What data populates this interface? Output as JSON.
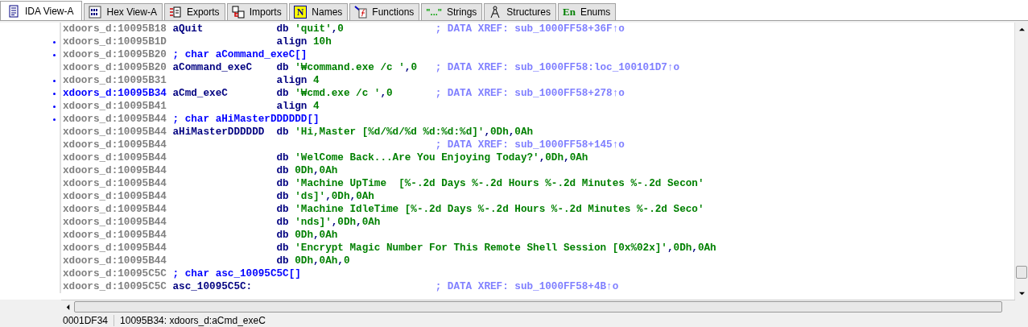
{
  "tabs": [
    {
      "label": "IDA View-A",
      "kind": "disasm",
      "selected": true
    },
    {
      "label": "Hex View-A",
      "kind": "hex",
      "selected": false
    },
    {
      "label": "Exports",
      "kind": "exports",
      "selected": false
    },
    {
      "label": "Imports",
      "kind": "imports",
      "selected": false
    },
    {
      "label": "Names",
      "kind": "names",
      "icon_text": "N",
      "selected": false
    },
    {
      "label": "Functions",
      "kind": "functions",
      "selected": false
    },
    {
      "label": "Strings",
      "kind": "strings",
      "icon_text": "\"...\"",
      "selected": false
    },
    {
      "label": "Structures",
      "kind": "structures",
      "selected": false
    },
    {
      "label": "Enums",
      "kind": "enums",
      "icon_text": "En",
      "selected": false
    }
  ],
  "listing": {
    "rows": [
      {
        "kind": "code",
        "address": "xdoors_d:10095B18",
        "bullet": false,
        "selected": false,
        "label": "aQuit",
        "mnemonic": "db",
        "operands": "'quit',0",
        "comment": "; DATA XREF: sub_1000FF58+36F↑o"
      },
      {
        "kind": "code",
        "address": "xdoors_d:10095B1D",
        "bullet": true,
        "selected": false,
        "mnemonic": "align",
        "operands": "10h"
      },
      {
        "kind": "decl",
        "address": "xdoors_d:10095B20",
        "bullet": true,
        "selected": false,
        "text": "; char aCommand_exeC[]"
      },
      {
        "kind": "code",
        "address": "xdoors_d:10095B20",
        "bullet": false,
        "selected": false,
        "label": "aCommand_exeC",
        "mnemonic": "db",
        "operands": "'₩command.exe /c ',0",
        "comment": "; DATA XREF: sub_1000FF58:loc_100101D7↑o"
      },
      {
        "kind": "code",
        "address": "xdoors_d:10095B31",
        "bullet": true,
        "selected": false,
        "mnemonic": "align",
        "operands": "4"
      },
      {
        "kind": "code",
        "address": "xdoors_d:10095B34",
        "bullet": true,
        "selected": true,
        "label": "aCmd_exeC",
        "mnemonic": "db",
        "operands": "'₩cmd.exe /c ',0",
        "comment": "; DATA XREF: sub_1000FF58+278↑o"
      },
      {
        "kind": "code",
        "address": "xdoors_d:10095B41",
        "bullet": true,
        "selected": false,
        "mnemonic": "align",
        "operands": "4"
      },
      {
        "kind": "decl",
        "address": "xdoors_d:10095B44",
        "bullet": true,
        "selected": false,
        "text": "; char aHiMasterDDDDDD[]"
      },
      {
        "kind": "code",
        "address": "xdoors_d:10095B44",
        "bullet": false,
        "selected": false,
        "label": "aHiMasterDDDDDD",
        "mnemonic": "db",
        "operands": "'Hi,Master [%d/%d/%d %d:%d:%d]',0Dh,0Ah"
      },
      {
        "kind": "code",
        "address": "xdoors_d:10095B44",
        "bullet": false,
        "selected": false,
        "comment": "; DATA XREF: sub_1000FF58+145↑o"
      },
      {
        "kind": "code",
        "address": "xdoors_d:10095B44",
        "bullet": false,
        "selected": false,
        "mnemonic": "db",
        "operands": "'WelCome Back...Are You Enjoying Today?',0Dh,0Ah"
      },
      {
        "kind": "code",
        "address": "xdoors_d:10095B44",
        "bullet": false,
        "selected": false,
        "mnemonic": "db",
        "operands": "0Dh,0Ah"
      },
      {
        "kind": "code",
        "address": "xdoors_d:10095B44",
        "bullet": false,
        "selected": false,
        "mnemonic": "db",
        "operands": "'Machine UpTime  [%-.2d Days %-.2d Hours %-.2d Minutes %-.2d Secon'"
      },
      {
        "kind": "code",
        "address": "xdoors_d:10095B44",
        "bullet": false,
        "selected": false,
        "mnemonic": "db",
        "operands": "'ds]',0Dh,0Ah"
      },
      {
        "kind": "code",
        "address": "xdoors_d:10095B44",
        "bullet": false,
        "selected": false,
        "mnemonic": "db",
        "operands": "'Machine IdleTime [%-.2d Days %-.2d Hours %-.2d Minutes %-.2d Seco'"
      },
      {
        "kind": "code",
        "address": "xdoors_d:10095B44",
        "bullet": false,
        "selected": false,
        "mnemonic": "db",
        "operands": "'nds]',0Dh,0Ah"
      },
      {
        "kind": "code",
        "address": "xdoors_d:10095B44",
        "bullet": false,
        "selected": false,
        "mnemonic": "db",
        "operands": "0Dh,0Ah"
      },
      {
        "kind": "code",
        "address": "xdoors_d:10095B44",
        "bullet": false,
        "selected": false,
        "mnemonic": "db",
        "operands": "'Encrypt Magic Number For This Remote Shell Session [0x%02x]',0Dh,0Ah"
      },
      {
        "kind": "code",
        "address": "xdoors_d:10095B44",
        "bullet": false,
        "selected": false,
        "mnemonic": "db",
        "operands": "0Dh,0Ah,0"
      },
      {
        "kind": "decl",
        "address": "xdoors_d:10095C5C",
        "bullet": false,
        "selected": false,
        "text": "; char asc_10095C5C[]"
      },
      {
        "kind": "code",
        "address": "xdoors_d:10095C5C",
        "bullet": false,
        "selected": false,
        "label": "asc_10095C5C:",
        "comment": "; DATA XREF: sub_1000FF58+4B↑o"
      }
    ]
  },
  "status_bar": {
    "offset": "0001DF34",
    "location": "10095B34: xdoors_d:aCmd_exeC"
  }
}
